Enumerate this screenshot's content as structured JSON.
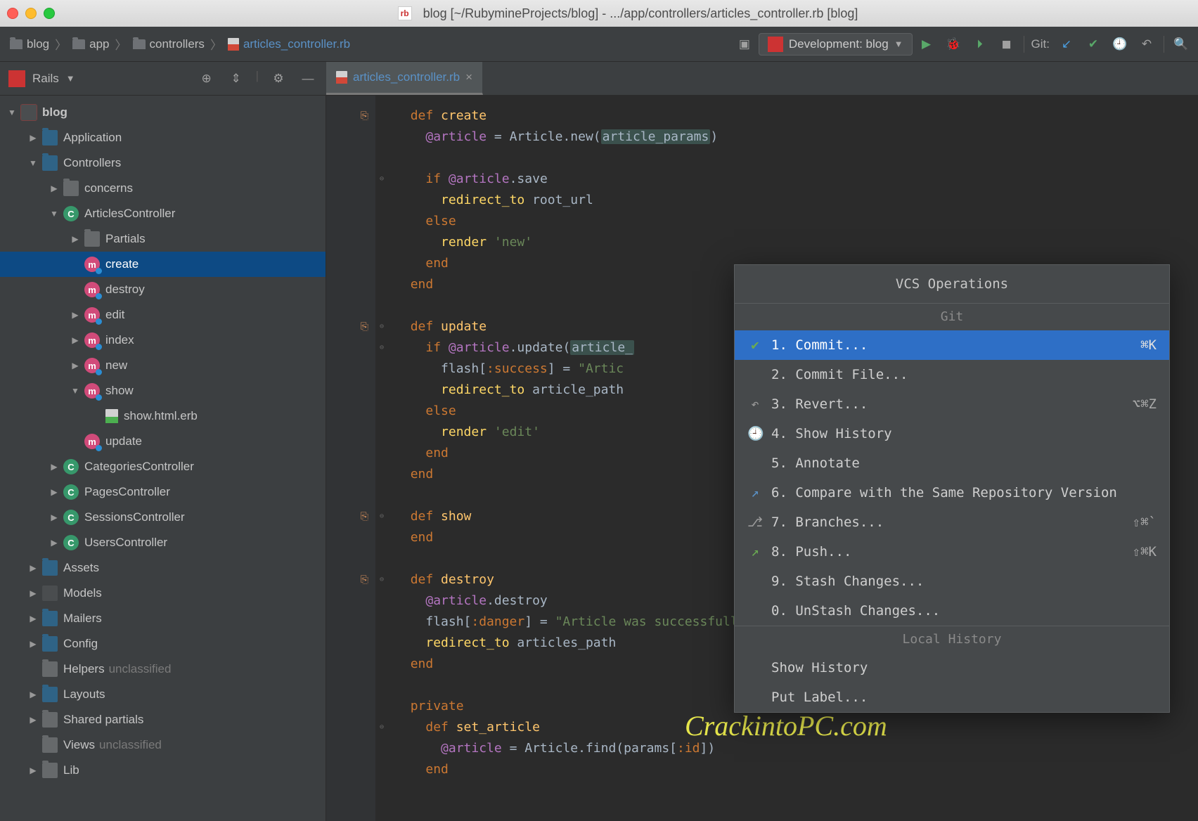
{
  "window": {
    "title": "blog [~/RubymineProjects/blog] - .../app/controllers/articles_controller.rb [blog]",
    "title_icon": "rb"
  },
  "breadcrumbs": [
    {
      "label": "blog",
      "icon": "folder"
    },
    {
      "label": "app",
      "icon": "folder"
    },
    {
      "label": "controllers",
      "icon": "folder"
    },
    {
      "label": "articles_controller.rb",
      "icon": "ruby-file",
      "current": true
    }
  ],
  "run_config": {
    "label": "Development: blog"
  },
  "toolbar_right": {
    "git_label": "Git:"
  },
  "rails_bar": {
    "label": "Rails"
  },
  "editor_tab": {
    "label": "articles_controller.rb"
  },
  "tree": [
    {
      "d": 0,
      "arrow": "down",
      "icon": "folder-red",
      "label": "blog",
      "bold": true
    },
    {
      "d": 1,
      "arrow": "right",
      "icon": "folder-blue",
      "label": "Application"
    },
    {
      "d": 1,
      "arrow": "down",
      "icon": "folder-blue",
      "label": "Controllers"
    },
    {
      "d": 2,
      "arrow": "right",
      "icon": "folder-gray",
      "label": "concerns"
    },
    {
      "d": 2,
      "arrow": "down",
      "icon": "class-c",
      "label": "ArticlesController"
    },
    {
      "d": 3,
      "arrow": "right",
      "icon": "folder-gray",
      "label": "Partials"
    },
    {
      "d": 3,
      "arrow": "",
      "icon": "method-m",
      "label": "create",
      "selected": true
    },
    {
      "d": 3,
      "arrow": "",
      "icon": "method-m",
      "label": "destroy"
    },
    {
      "d": 3,
      "arrow": "right",
      "icon": "method-m",
      "label": "edit"
    },
    {
      "d": 3,
      "arrow": "right",
      "icon": "method-m",
      "label": "index"
    },
    {
      "d": 3,
      "arrow": "right",
      "icon": "method-m",
      "label": "new"
    },
    {
      "d": 3,
      "arrow": "down",
      "icon": "method-m",
      "label": "show"
    },
    {
      "d": 4,
      "arrow": "",
      "icon": "erb",
      "label": "show.html.erb"
    },
    {
      "d": 3,
      "arrow": "",
      "icon": "method-m",
      "label": "update"
    },
    {
      "d": 2,
      "arrow": "right",
      "icon": "class-c",
      "label": "CategoriesController"
    },
    {
      "d": 2,
      "arrow": "right",
      "icon": "class-c",
      "label": "PagesController"
    },
    {
      "d": 2,
      "arrow": "right",
      "icon": "class-c",
      "label": "SessionsController"
    },
    {
      "d": 2,
      "arrow": "right",
      "icon": "class-c",
      "label": "UsersController"
    },
    {
      "d": 1,
      "arrow": "right",
      "icon": "folder-blue",
      "label": "Assets"
    },
    {
      "d": 1,
      "arrow": "right",
      "icon": "models",
      "label": "Models"
    },
    {
      "d": 1,
      "arrow": "right",
      "icon": "folder-blue",
      "label": "Mailers"
    },
    {
      "d": 1,
      "arrow": "right",
      "icon": "folder-blue",
      "label": "Config"
    },
    {
      "d": 1,
      "arrow": "",
      "icon": "folder-gray",
      "label": "Helpers",
      "suffix": "unclassified"
    },
    {
      "d": 1,
      "arrow": "right",
      "icon": "folder-blue",
      "label": "Layouts"
    },
    {
      "d": 1,
      "arrow": "right",
      "icon": "folder-gray",
      "label": "Shared partials"
    },
    {
      "d": 1,
      "arrow": "",
      "icon": "folder-gray",
      "label": "Views",
      "suffix": "unclassified"
    },
    {
      "d": 1,
      "arrow": "right",
      "icon": "folder-gray",
      "label": "Lib"
    }
  ],
  "code_lines": [
    {
      "gutter": "action",
      "html": "  <span class='kw'>def</span> <span class='fn'>create</span>"
    },
    {
      "html": "    <span class='ivar'>@article</span> = <span class='const'>Article</span>.new(<span class='param-hl'>article_params</span>)"
    },
    {
      "html": ""
    },
    {
      "fold": "⊖",
      "html": "    <span class='kw'>if</span> <span class='ivar'>@article</span>.save"
    },
    {
      "html": "      <span class='method'>redirect_to</span> root_url"
    },
    {
      "html": "    <span class='kw'>else</span>"
    },
    {
      "html": "      <span class='method'>render</span> <span class='str'>'new'</span>"
    },
    {
      "html": "    <span class='kw'>end</span>"
    },
    {
      "html": "  <span class='kw'>end</span>"
    },
    {
      "html": ""
    },
    {
      "gutter": "action",
      "fold": "⊖",
      "html": "  <span class='kw'>def</span> <span class='fn'>update</span>"
    },
    {
      "fold": "⊖",
      "html": "    <span class='kw'>if</span> <span class='ivar'>@article</span>.update(<span class='param-hl'>article_</span>"
    },
    {
      "html": "      flash[<span class='sym'>:success</span>] = <span class='str'>\"Artic</span>"
    },
    {
      "html": "      <span class='method'>redirect_to</span> article_path"
    },
    {
      "html": "    <span class='kw'>else</span>"
    },
    {
      "html": "      <span class='method'>render</span> <span class='str'>'edit'</span>"
    },
    {
      "html": "    <span class='kw'>end</span>"
    },
    {
      "html": "  <span class='kw'>end</span>"
    },
    {
      "html": ""
    },
    {
      "gutter": "action",
      "fold": "⊖",
      "html": "  <span class='kw'>def</span> <span class='fn'>show</span>"
    },
    {
      "html": "  <span class='kw'>end</span>"
    },
    {
      "html": ""
    },
    {
      "gutter": "action",
      "fold": "⊖",
      "html": "  <span class='kw'>def</span> <span class='fn'>destroy</span>"
    },
    {
      "html": "    <span class='ivar'>@article</span>.destroy"
    },
    {
      "html": "    flash[<span class='sym'>:danger</span>] = <span class='str'>\"Article was successfully deleted\"</span>"
    },
    {
      "html": "    <span class='method'>redirect_to</span> articles_path"
    },
    {
      "html": "  <span class='kw'>end</span>"
    },
    {
      "html": ""
    },
    {
      "html": "  <span class='kw'>private</span>"
    },
    {
      "fold": "⊖",
      "html": "    <span class='kw'>def</span> <span class='fn'>set_article</span>"
    },
    {
      "html": "      <span class='ivar'>@article</span> = <span class='const'>Article</span>.find(params[<span class='sym'>:id</span>])"
    },
    {
      "html": "    <span class='kw'>end</span>"
    },
    {
      "html": ""
    }
  ],
  "popup": {
    "title": "VCS Operations",
    "section_git": "Git",
    "section_local": "Local History",
    "items": [
      {
        "icon": "check",
        "label": "1. Commit...",
        "shortcut": "⌘K",
        "selected": true
      },
      {
        "icon": "",
        "label": "2. Commit File..."
      },
      {
        "icon": "revert",
        "label": "3. Revert...",
        "shortcut": "⌥⌘Z"
      },
      {
        "icon": "history",
        "label": "4. Show History"
      },
      {
        "icon": "",
        "label": "5. Annotate"
      },
      {
        "icon": "compare",
        "label": "6. Compare with the Same Repository Version"
      },
      {
        "icon": "branch",
        "label": "7. Branches...",
        "shortcut": "⇧⌘`"
      },
      {
        "icon": "push",
        "label": "8. Push...",
        "shortcut": "⇧⌘K"
      },
      {
        "icon": "",
        "label": "9. Stash Changes..."
      },
      {
        "icon": "",
        "label": "0. UnStash Changes..."
      }
    ],
    "local_items": [
      {
        "label": "Show History"
      },
      {
        "label": "Put Label..."
      }
    ]
  },
  "watermark": "CrackintoPC.com"
}
